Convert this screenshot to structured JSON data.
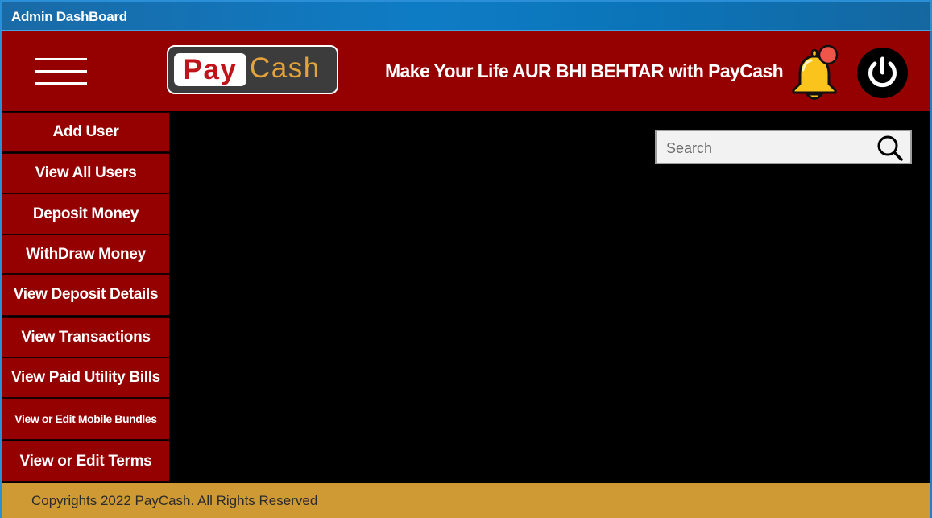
{
  "window": {
    "title": "Admin DashBoard"
  },
  "header": {
    "logo": {
      "part1": "Pay",
      "part2": "Cash",
      "colors": {
        "pay": "#c0141b",
        "cash": "#e3a23a"
      }
    },
    "tagline": "Make Your Life AUR BHI BEHTAR with PayCash",
    "icons": [
      "hamburger-menu-icon",
      "bell-icon",
      "power-icon"
    ],
    "bell_notification": true,
    "background": "#950000"
  },
  "sidebar": {
    "items": [
      {
        "label": "Add User"
      },
      {
        "label": "View All Users"
      },
      {
        "label": "Deposit Money"
      },
      {
        "label": "WithDraw Money"
      },
      {
        "label": "View Deposit Details"
      },
      {
        "label": "View Transactions"
      },
      {
        "label": "View Paid Utility Bills"
      },
      {
        "label": "View or Edit Mobile Bundles"
      },
      {
        "label": "View or Edit Terms"
      }
    ]
  },
  "search": {
    "placeholder": "Search",
    "value": "",
    "icon": "search-icon"
  },
  "footer": {
    "text": "Copyrights 2022 PayCash. All Rights Reserved",
    "background": "#cf9a33"
  }
}
